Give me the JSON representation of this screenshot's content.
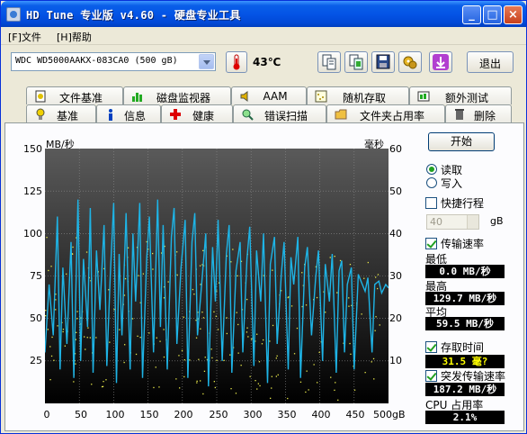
{
  "window": {
    "title": "HD Tune 专业版 v4.60 - 硬盘专业工具",
    "minimize_glyph": "_",
    "maximize_glyph": "□",
    "close_glyph": "×"
  },
  "menu": {
    "items": [
      {
        "label": "[F]文件"
      },
      {
        "label": "[H]帮助"
      }
    ]
  },
  "toolbar": {
    "drive": "WDC WD5000AAKX-083CA0 (500 gB)",
    "temperature": "43℃",
    "exit_label": "退出",
    "icons": [
      "thermometer-icon",
      "copy-text-icon",
      "copy-screenshot-icon",
      "save-icon",
      "options-icon",
      "download-icon"
    ]
  },
  "tabs": {
    "row1": [
      {
        "label": "文件基准",
        "icon": "file-benchmark-icon"
      },
      {
        "label": "磁盘监视器",
        "icon": "disk-monitor-icon"
      },
      {
        "label": "AAM",
        "icon": "speaker-icon"
      },
      {
        "label": "随机存取",
        "icon": "random-access-icon"
      },
      {
        "label": "额外测试",
        "icon": "extra-tests-icon"
      }
    ],
    "row2": [
      {
        "label": "基准",
        "icon": "benchmark-icon",
        "active": true
      },
      {
        "label": "信息",
        "icon": "info-icon"
      },
      {
        "label": "健康",
        "icon": "health-icon"
      },
      {
        "label": "错误扫描",
        "icon": "error-scan-icon"
      },
      {
        "label": "文件夹占用率",
        "icon": "folder-usage-icon"
      },
      {
        "label": "删除",
        "icon": "erase-icon"
      }
    ]
  },
  "chart_data": {
    "type": "line",
    "ylabel_left": "MB/秒",
    "ylabel_right": "毫秒",
    "left_ticks": [
      "150",
      "125",
      "100",
      "75",
      "50",
      "25"
    ],
    "right_ticks": [
      "60",
      "50",
      "40",
      "30",
      "20",
      "10"
    ],
    "x_ticks": [
      "0",
      "50",
      "100",
      "150",
      "200",
      "250",
      "300",
      "350",
      "400",
      "450",
      "500gB"
    ],
    "xlim": [
      0,
      500
    ],
    "ylim_left": [
      0,
      150
    ],
    "ylim_right": [
      0,
      60
    ],
    "grid": true,
    "series": [
      {
        "role": "transfer_rate",
        "color": "#1eb4e6",
        "x": [
          0,
          6,
          12,
          18,
          22,
          26,
          32,
          38,
          42,
          48,
          52,
          56,
          62,
          66,
          70,
          75,
          80,
          86,
          90,
          95,
          100,
          104,
          108,
          112,
          118,
          124,
          128,
          132,
          138,
          142,
          148,
          152,
          158,
          164,
          168,
          172,
          178,
          184,
          188,
          192,
          198,
          204,
          208,
          214,
          218,
          222,
          228,
          234,
          238,
          244,
          248,
          252,
          258,
          264,
          268,
          272,
          278,
          284,
          288,
          294,
          298,
          304,
          308,
          314,
          318,
          324,
          328,
          334,
          338,
          344,
          348,
          354,
          358,
          362,
          368,
          372,
          378,
          382,
          388,
          394,
          398,
          404,
          408,
          414,
          418,
          424,
          428,
          432,
          436,
          440,
          446,
          450,
          456,
          460,
          466,
          470,
          476,
          480,
          486,
          490,
          496,
          500
        ],
        "values": [
          30,
          70,
          40,
          110,
          20,
          80,
          35,
          95,
          15,
          120,
          25,
          85,
          45,
          115,
          18,
          90,
          55,
          105,
          22,
          75,
          118,
          12,
          88,
          40,
          112,
          20,
          100,
          60,
          118,
          15,
          85,
          110,
          30,
          120,
          45,
          105,
          20,
          98,
          115,
          35,
          80,
          108,
          15,
          95,
          112,
          40,
          70,
          100,
          10,
          92,
          60,
          108,
          25,
          88,
          105,
          18,
          78,
          95,
          30,
          85,
          104,
          22,
          90,
          60,
          100,
          12,
          82,
          98,
          35,
          76,
          95,
          20,
          86,
          70,
          98,
          15,
          80,
          92,
          40,
          74,
          90,
          25,
          82,
          60,
          88,
          18,
          78,
          84,
          30,
          70,
          80,
          20,
          76,
          72,
          66,
          74,
          30,
          70,
          72,
          65,
          70,
          68
        ]
      },
      {
        "role": "access_time_points",
        "color": "#e8e84a",
        "unit": "ms"
      }
    ]
  },
  "right_panel": {
    "start_label": "开始",
    "read_label": "读取",
    "read_selected": true,
    "write_label": "写入",
    "write_selected": false,
    "short_stroke_label": "快捷行程",
    "short_stroke_checked": false,
    "short_stroke_value": "40",
    "short_stroke_unit": "gB",
    "transfer_rate_label": "传输速率",
    "transfer_rate_checked": true,
    "min_label": "最低",
    "min_value": "0.0 MB/秒",
    "max_label": "最高",
    "max_value": "129.7 MB/秒",
    "avg_label": "平均",
    "avg_value": "59.5 MB/秒",
    "access_time_label": "存取时间",
    "access_time_checked": true,
    "access_time_value": "31.5 毫?",
    "burst_rate_label": "突发传输速率",
    "burst_rate_checked": true,
    "burst_rate_value": "187.2 MB/秒",
    "cpu_label": "CPU 占用率",
    "cpu_value": "2.1%"
  }
}
